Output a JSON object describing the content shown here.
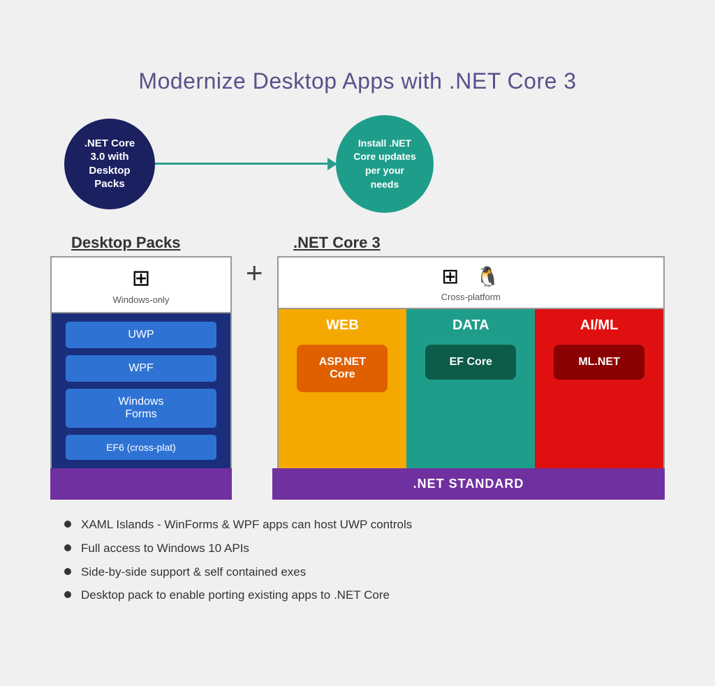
{
  "title": "Modernize Desktop Apps with .NET Core 3",
  "arrow": {
    "left_circle": ".NET Core\n3.0 with\nDesktop\nPacks",
    "right_circle": "Install .NET\nCore updates\nper your\nneeds"
  },
  "labels": {
    "desktop_packs": "Desktop Packs",
    "net_core3": ".NET Core 3"
  },
  "desktop_packs": {
    "windows_icon": "⊞",
    "windows_only": "Windows-only",
    "items": [
      "UWP",
      "WPF",
      "Windows\nForms",
      "EF6 (cross-plat)"
    ]
  },
  "plus": "+",
  "net_core": {
    "os_icons": [
      "⊞",
      "",
      ""
    ],
    "cross_platform": "Cross-platform",
    "columns": [
      {
        "id": "web",
        "header": "WEB",
        "badge": "ASP.NET\nCore"
      },
      {
        "id": "data",
        "header": "DATA",
        "badge": "EF Core"
      },
      {
        "id": "aiml",
        "header": "AI/ML",
        "badge": "ML.NET"
      }
    ]
  },
  "net_standard_bar": ".NET STANDARD",
  "bullets": [
    "XAML Islands - WinForms & WPF apps can host UWP controls",
    "Full access to Windows 10 APIs",
    "Side-by-side support & self contained exes",
    "Desktop pack to enable porting existing apps to .NET Core"
  ]
}
